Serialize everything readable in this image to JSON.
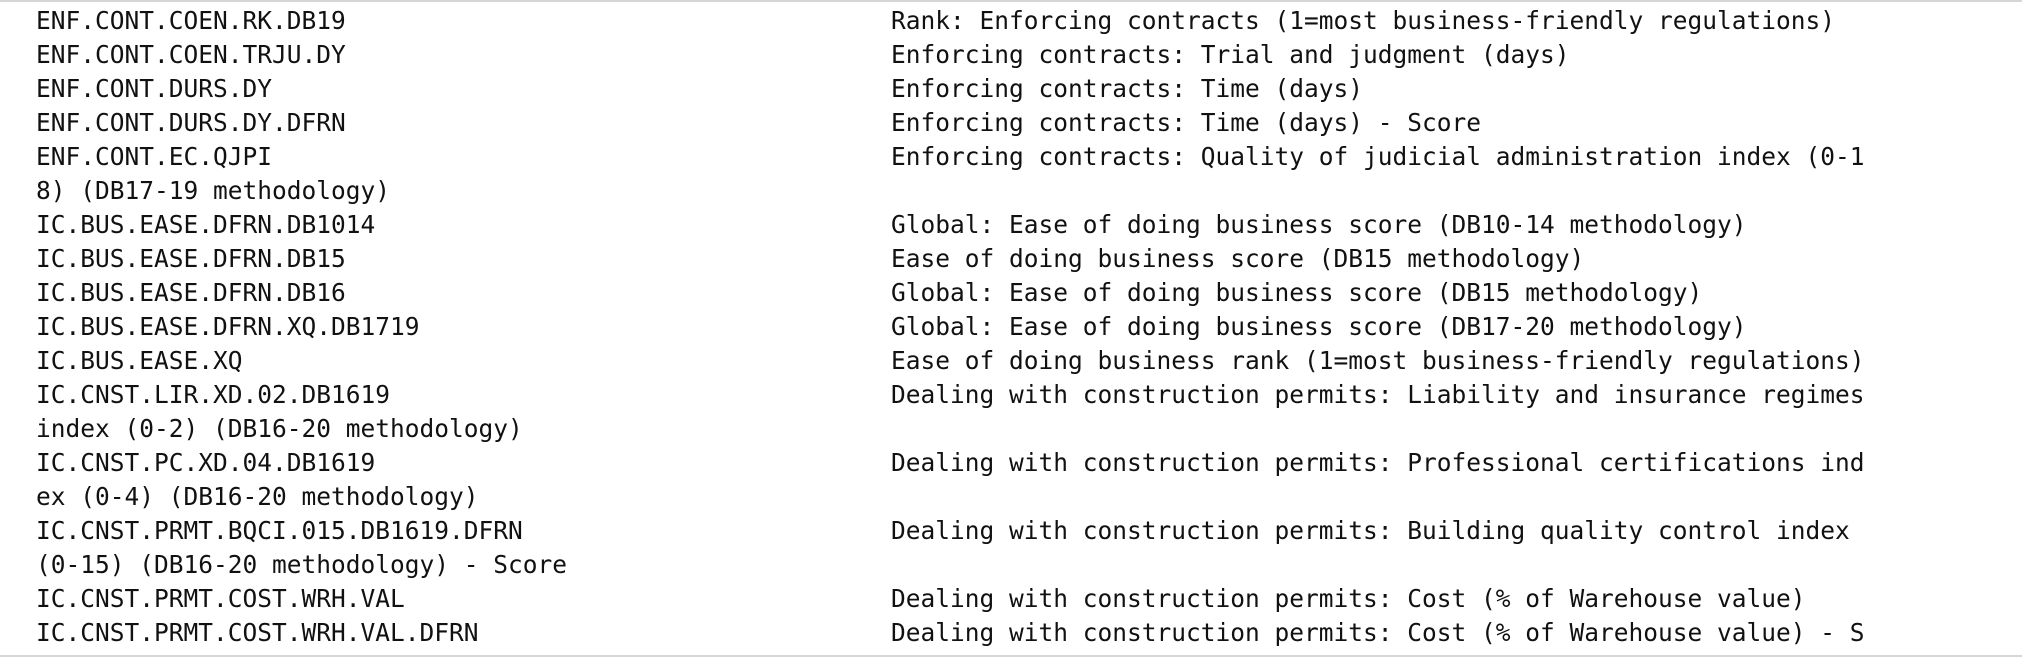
{
  "window": {
    "title": "",
    "background": "#ffffff",
    "text_color": "#111111"
  },
  "rows": [
    {
      "code": "ENF.CONT.COEN.RK.DB19",
      "desc": "Rank: Enforcing contracts (1=most business-friendly regulations)"
    },
    {
      "code": "ENF.CONT.COEN.TRJU.DY",
      "desc": "Enforcing contracts: Trial and judgment (days)"
    },
    {
      "code": "ENF.CONT.DURS.DY",
      "desc": "Enforcing contracts: Time (days)"
    },
    {
      "code": "ENF.CONT.DURS.DY.DFRN",
      "desc": "Enforcing contracts: Time (days) - Score"
    },
    {
      "code": "ENF.CONT.EC.QJPI",
      "desc": "Enforcing contracts: Quality of judicial administration index (0-1"
    },
    {
      "code": "8) (DB17-19 methodology)",
      "desc": ""
    },
    {
      "code": "IC.BUS.EASE.DFRN.DB1014",
      "desc": "Global: Ease of doing business score (DB10-14 methodology)"
    },
    {
      "code": "IC.BUS.EASE.DFRN.DB15",
      "desc": "Ease of doing business score (DB15 methodology)"
    },
    {
      "code": "IC.BUS.EASE.DFRN.DB16",
      "desc": "Global: Ease of doing business score (DB15 methodology)"
    },
    {
      "code": "IC.BUS.EASE.DFRN.XQ.DB1719",
      "desc": "Global: Ease of doing business score (DB17-20 methodology)"
    },
    {
      "code": "IC.BUS.EASE.XQ",
      "desc": "Ease of doing business rank (1=most business-friendly regulations)"
    },
    {
      "code": "IC.CNST.LIR.XD.02.DB1619",
      "desc": "Dealing with construction permits: Liability and insurance regimes"
    },
    {
      "code": "index (0-2) (DB16-20 methodology)",
      "desc": ""
    },
    {
      "code": "IC.CNST.PC.XD.04.DB1619",
      "desc": "Dealing with construction permits: Professional certifications ind"
    },
    {
      "code": "ex (0-4) (DB16-20 methodology)",
      "desc": ""
    },
    {
      "code": "IC.CNST.PRMT.BQCI.015.DB1619.DFRN",
      "desc": "Dealing with construction permits: Building quality control index"
    },
    {
      "code": "(0-15) (DB16-20 methodology) - Score",
      "desc": ""
    },
    {
      "code": "IC.CNST.PRMT.COST.WRH.VAL",
      "desc": "Dealing with construction permits: Cost (% of Warehouse value)"
    },
    {
      "code": "IC.CNST.PRMT.COST.WRH.VAL.DFRN",
      "desc": "Dealing with construction permits: Cost (% of Warehouse value) - S"
    }
  ]
}
